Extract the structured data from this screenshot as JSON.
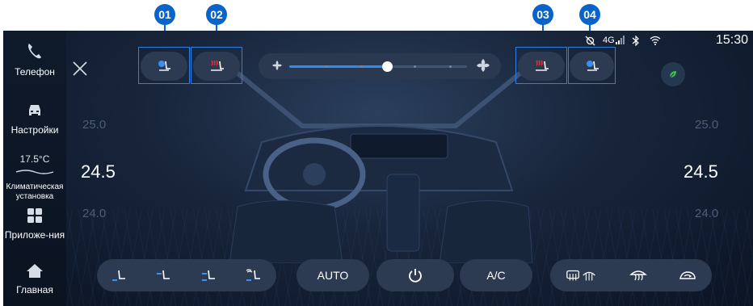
{
  "callouts": [
    "01",
    "02",
    "03",
    "04"
  ],
  "sidebar": {
    "items": [
      {
        "label": "Телефон",
        "icon": "phone-icon"
      },
      {
        "label": "Настройки",
        "icon": "car-icon"
      },
      {
        "temp": "17.5°C",
        "label": "Климатическая установка"
      },
      {
        "label": "Приложе-ния",
        "icon": "apps-icon"
      },
      {
        "label": "Главная",
        "icon": "home-icon"
      }
    ]
  },
  "status": {
    "network": "4G",
    "time": "15:30"
  },
  "fan": {
    "level_fraction": 0.55
  },
  "left_temps": [
    "25.0",
    "24.5",
    "24.0"
  ],
  "right_temps": [
    "25.0",
    "24.5",
    "24.0"
  ],
  "bottom": {
    "auto_label": "AUTO",
    "ac_label": "A/C"
  },
  "colors": {
    "accent": "#0a63c9",
    "heat": "#e0303a",
    "vent": "#3a8ff0",
    "eco": "#3fbf4a"
  }
}
